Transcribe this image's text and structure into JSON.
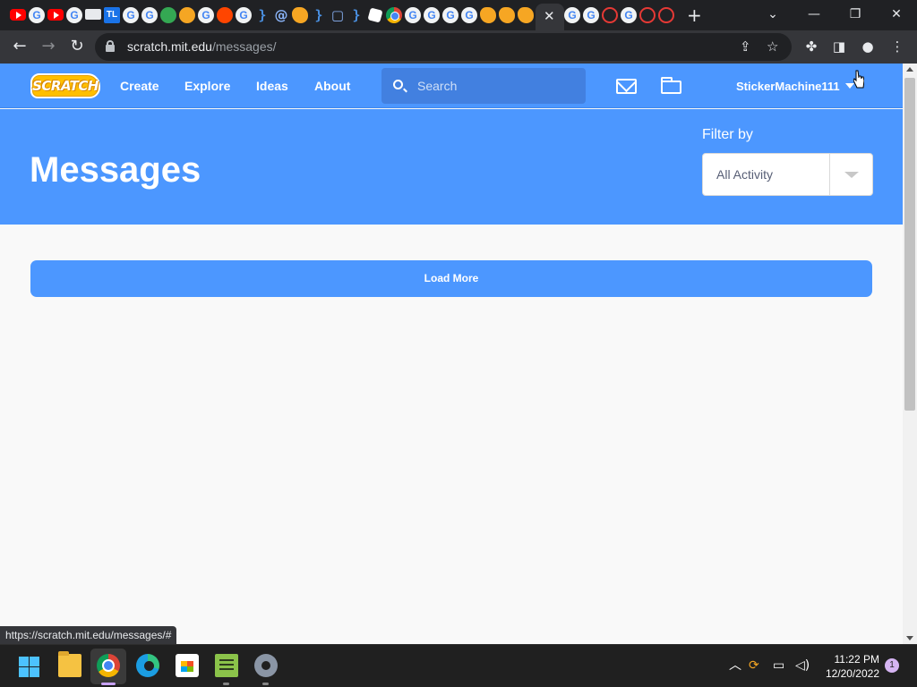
{
  "browser": {
    "active_tab_close": "✕",
    "new_tab": "+",
    "url_host": "scratch.mit.edu",
    "url_path": "/messages/",
    "status_url": "https://scratch.mit.edu/messages/#",
    "window_controls": {
      "tab_search": "⌄",
      "minimize": "—",
      "restore": "❐",
      "close": "✕"
    },
    "toolbar_icons": [
      "share-icon",
      "star-icon",
      "extensions-icon",
      "side-panel-icon",
      "profile-icon",
      "menu-icon"
    ]
  },
  "scratch": {
    "logo_text": "SCRATCH",
    "nav": {
      "create": "Create",
      "explore": "Explore",
      "ideas": "Ideas",
      "about": "About"
    },
    "search": {
      "placeholder": "Search"
    },
    "username": "StickerMachine111",
    "colors": {
      "brand_blue": "#4c97ff",
      "logo_yellow": "#ffbf00"
    }
  },
  "page": {
    "title": "Messages",
    "filter_label": "Filter by",
    "filter_value": "All Activity",
    "load_more": "Load More"
  },
  "taskbar": {
    "time": "11:22 PM",
    "date": "12/20/2022",
    "notification_count": "1",
    "apps": [
      "start-icon",
      "file-explorer-icon",
      "chrome-icon",
      "edge-icon",
      "store-icon",
      "notepad-icon",
      "settings-icon"
    ]
  }
}
